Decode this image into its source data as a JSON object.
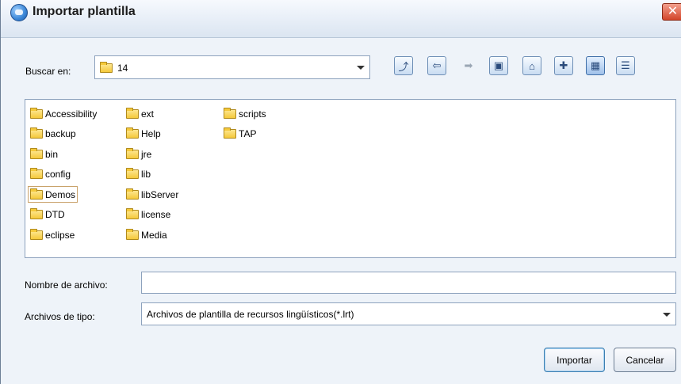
{
  "window": {
    "title": "Importar plantilla",
    "close_glyph": "✕"
  },
  "look_in": {
    "label": "Buscar en:",
    "value": "14"
  },
  "toolbar": {
    "buttons": [
      {
        "name": "up-folder-icon",
        "glyph": "⤴"
      },
      {
        "name": "back-arrow-icon",
        "glyph": "⇦"
      },
      {
        "name": "forward-arrow-icon",
        "glyph": "➡"
      },
      {
        "name": "desktop-icon",
        "glyph": "▣"
      },
      {
        "name": "home-icon",
        "glyph": "⌂"
      },
      {
        "name": "new-folder-icon",
        "glyph": "✚"
      },
      {
        "name": "list-view-icon",
        "glyph": "▦"
      },
      {
        "name": "details-view-icon",
        "glyph": "☰"
      }
    ]
  },
  "files": {
    "col1": [
      "Accessibility",
      "backup",
      "bin",
      "config",
      "Demos",
      "DTD",
      "eclipse"
    ],
    "col2": [
      "ext",
      "Help",
      "jre",
      "lib",
      "libServer",
      "license",
      "Media"
    ],
    "col3": [
      "scripts",
      "TAP"
    ],
    "focused": "Demos"
  },
  "filename": {
    "label": "Nombre de archivo:",
    "value": ""
  },
  "filetype": {
    "label": "Archivos de tipo:",
    "value": "Archivos de plantilla de recursos lingüísticos(*.lrt)"
  },
  "buttons": {
    "import": "Importar",
    "cancel": "Cancelar"
  }
}
